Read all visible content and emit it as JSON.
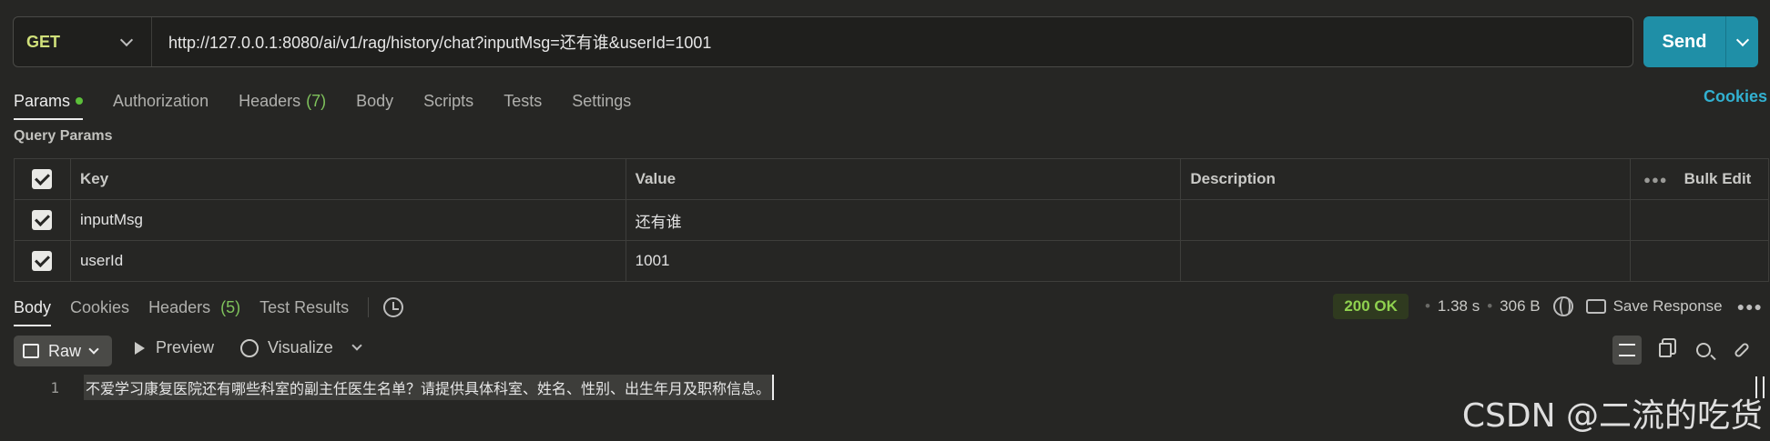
{
  "request": {
    "method": "GET",
    "url": "http://127.0.0.1:8080/ai/v1/rag/history/chat?inputMsg=还有谁&userId=1001",
    "send_label": "Send"
  },
  "request_tabs": [
    {
      "label": "Params",
      "active": true,
      "has_dot": true
    },
    {
      "label": "Authorization"
    },
    {
      "label": "Headers",
      "count": "(7)"
    },
    {
      "label": "Body"
    },
    {
      "label": "Scripts"
    },
    {
      "label": "Tests"
    },
    {
      "label": "Settings"
    }
  ],
  "cookies_link": "Cookies",
  "query_params": {
    "title": "Query Params",
    "headers": {
      "key": "Key",
      "value": "Value",
      "description": "Description",
      "bulk_edit": "Bulk Edit"
    },
    "rows": [
      {
        "checked": true,
        "key": "inputMsg",
        "value": "还有谁",
        "description": ""
      },
      {
        "checked": true,
        "key": "userId",
        "value": "1001",
        "description": ""
      }
    ]
  },
  "response_tabs": [
    {
      "label": "Body",
      "active": true
    },
    {
      "label": "Cookies"
    },
    {
      "label": "Headers",
      "count": "(5)"
    },
    {
      "label": "Test Results"
    }
  ],
  "response_meta": {
    "status": "200 OK",
    "time": "1.38 s",
    "size": "306 B",
    "save_label": "Save Response"
  },
  "response_toolbar": {
    "raw_label": "Raw",
    "preview_label": "Preview",
    "visualize_label": "Visualize"
  },
  "response_body": {
    "line_number": "1",
    "text": "不爱学习康复医院还有哪些科室的副主任医生名单？请提供具体科室、姓名、性别、出生年月及职称信息。"
  },
  "watermark": "CSDN @二流的吃货"
}
